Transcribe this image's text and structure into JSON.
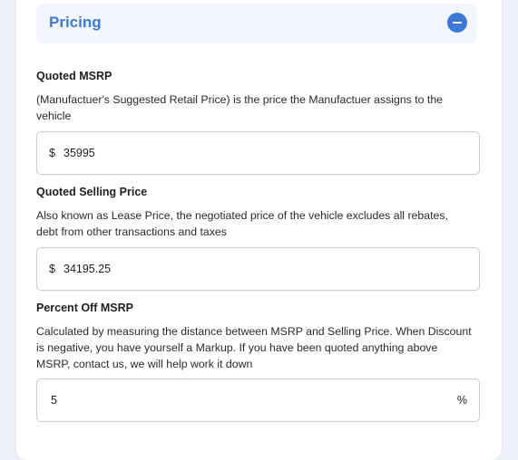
{
  "section": {
    "title": "Pricing"
  },
  "msrp": {
    "label": "Quoted MSRP",
    "description": "(Manufactuer's Suggested Retail Price) is the price the Manufactuer assigns to the vehicle",
    "prefix": "$",
    "value": "35995"
  },
  "selling_price": {
    "label": "Quoted Selling Price",
    "description": "Also known as Lease Price, the negotiated price of the vehicle excludes all rebates, debt from other transactions and taxes",
    "prefix": "$",
    "value": "34195.25"
  },
  "percent_off": {
    "label": "Percent Off MSRP",
    "description": "Calculated by measuring the distance between MSRP and Selling Price. When Discount is negative, you have yourself a Markup. If you have been quoted anything above MSRP, contact us, we will help work it down",
    "value": "5",
    "suffix": "%"
  },
  "colors": {
    "accent": "#3d7ad6",
    "header_bg": "#f3f6fc",
    "page_bg": "#eef2f8"
  }
}
